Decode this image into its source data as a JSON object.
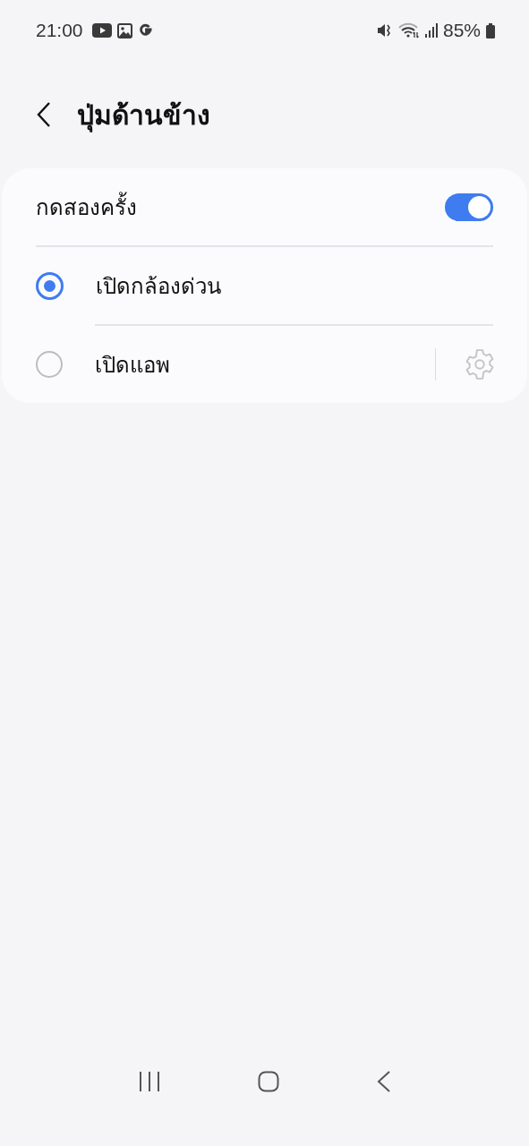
{
  "status_bar": {
    "time": "21:00",
    "battery": "85%"
  },
  "header": {
    "title": "ปุ่มด้านข้าง"
  },
  "double_press": {
    "label": "กดสองครั้ง",
    "on": true
  },
  "options": [
    {
      "label": "เปิดกล้องด่วน",
      "selected": true,
      "kind": "plain"
    },
    {
      "label": "เปิดแอพ",
      "selected": false,
      "kind": "with-settings",
      "settings_disabled": true
    }
  ]
}
